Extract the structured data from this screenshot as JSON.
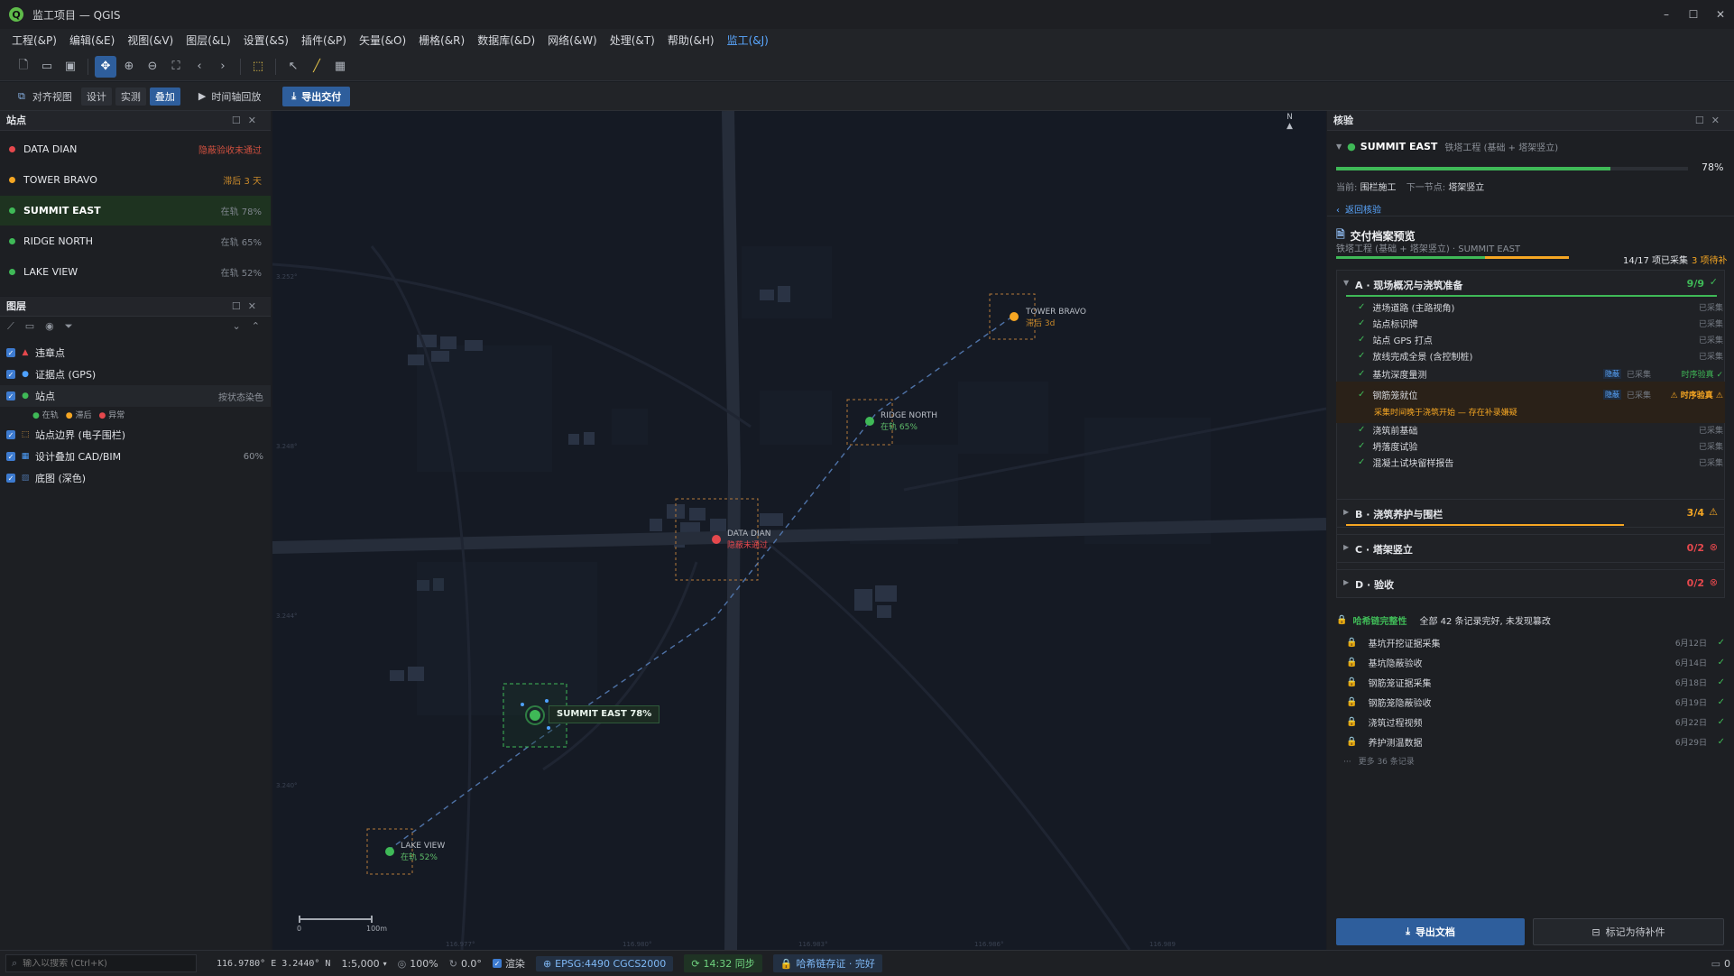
{
  "window": {
    "title": "监工项目 — QGIS",
    "controls": [
      "–",
      "☐",
      "✕"
    ]
  },
  "menu": [
    "工程(&P)",
    "编辑(&E)",
    "视图(&V)",
    "图层(&L)",
    "设置(&S)",
    "插件(&P)",
    "矢量(&O)",
    "栅格(&R)",
    "数据库(&D)",
    "网络(&W)",
    "处理(&T)",
    "帮助(&H)",
    "监工(&J)"
  ],
  "toolbar2": {
    "align_view": "对齐视图",
    "seg_design": "设计",
    "seg_survey": "实测",
    "seg_overlay": "叠加",
    "timeline": "时间轴回放",
    "export_delivery": "导出交付"
  },
  "sites_panel": {
    "title": "站点",
    "items": [
      {
        "name": "DATA DIAN",
        "status": "隐蔽验收未通过",
        "color": "#e5484d"
      },
      {
        "name": "TOWER BRAVO",
        "status": "滞后 3 天",
        "color": "#f5a623"
      },
      {
        "name": "SUMMIT EAST",
        "status": "在轨 78%",
        "color": "#3fb957"
      },
      {
        "name": "RIDGE NORTH",
        "status": "在轨 65%",
        "color": "#3fb957"
      },
      {
        "name": "LAKE VIEW",
        "status": "在轨 52%",
        "color": "#3fb957"
      }
    ]
  },
  "layers_panel": {
    "title": "图层",
    "layers": [
      {
        "name": "违章点",
        "right": ""
      },
      {
        "name": "证据点 (GPS)",
        "right": ""
      },
      {
        "name": "站点",
        "right": "按状态染色"
      },
      {
        "name": "站点边界 (电子围栏)",
        "right": ""
      },
      {
        "name": "设计叠加 CAD/BIM",
        "right": "60%"
      },
      {
        "name": "底图 (深色)",
        "right": ""
      }
    ],
    "legend": [
      "在轨",
      "滞后",
      "异常"
    ]
  },
  "map": {
    "north": "N",
    "labels": {
      "tower_bravo": "TOWER BRAVO",
      "tower_bravo_sub": "滞后 3d",
      "ridge_north": "RIDGE NORTH",
      "ridge_north_sub": "在轨 65%",
      "data_dian": "DATA DIAN",
      "data_dian_sub": "隐蔽未通过",
      "summit_east": "SUMMIT EAST 78%",
      "lake_view": "LAKE VIEW",
      "lake_view_sub": "在轨 52%"
    },
    "scale": {
      "zero": "0",
      "end": "100m"
    },
    "lat_ticks": [
      "3.252°",
      "3.248°",
      "3.244°",
      "3.240°"
    ],
    "lon_ticks": [
      "116.977°",
      "116.980°",
      "116.983°",
      "116.986°",
      "116.989"
    ]
  },
  "inspect": {
    "panel_title": "核验",
    "site_name": "SUMMIT EAST",
    "site_type": "铁塔工程 (基础 + 塔架竖立)",
    "progress_value": 78,
    "progress_pct": "78%",
    "current_label": "当前:",
    "current_value": "围栏施工",
    "next_label": "下一节点:",
    "next_value": "塔架竖立",
    "back_link": "返回核验",
    "archive_title": "交付档案预览",
    "archive_sub": "铁塔工程 (基础 + 塔架竖立) · SUMMIT EAST",
    "archive_count": "14/17 项已采集",
    "archive_pending": "3 项待补",
    "sectionA": {
      "title": "A · 现场概况与浇筑准备",
      "count": "9/9",
      "items": [
        {
          "name": "进场道路 (主路视角)",
          "tag": "",
          "status": "已采集"
        },
        {
          "name": "站点标识牌",
          "tag": "",
          "status": "已采集"
        },
        {
          "name": "站点 GPS 打点",
          "tag": "",
          "status": "已采集"
        },
        {
          "name": "放线完成全景 (含控制桩)",
          "tag": "",
          "status": "已采集"
        },
        {
          "name": "基坑深度量测",
          "tag": "隐蔽",
          "status": "已采集",
          "extra": "时序验真 ✓"
        },
        {
          "name": "钢筋笼就位",
          "tag": "隐蔽",
          "status": "已采集",
          "extra": "⚠ 时序验真 ⚠"
        },
        {
          "name": "浇筑前基础",
          "tag": "",
          "status": "已采集"
        },
        {
          "name": "坍落度试验",
          "tag": "",
          "status": "已采集"
        },
        {
          "name": "混凝土试块留样报告",
          "tag": "",
          "status": "已采集"
        }
      ],
      "warning": "采集时间晚于浇筑开始 — 存在补录嫌疑"
    },
    "sectionB": {
      "title": "B · 浇筑养护与围栏",
      "count": "3/4"
    },
    "sectionC": {
      "title": "C · 塔架竖立",
      "count": "0/2"
    },
    "sectionD": {
      "title": "D · 验收",
      "count": "0/2"
    },
    "chain_title": "哈希链完整性",
    "chain_desc": "全部 42 条记录完好, 未发现篡改",
    "chain_items": [
      {
        "name": "基坑开挖证据采集",
        "date": "6月12日"
      },
      {
        "name": "基坑隐蔽验收",
        "date": "6月14日"
      },
      {
        "name": "钢筋笼证据采集",
        "date": "6月18日"
      },
      {
        "name": "钢筋笼隐蔽验收",
        "date": "6月19日"
      },
      {
        "name": "浇筑过程视频",
        "date": "6月22日"
      },
      {
        "name": "养护测温数据",
        "date": "6月29日"
      }
    ],
    "chain_more": "更多 36 条记录",
    "export_doc": "导出文档",
    "mark_pending": "标记为待补件"
  },
  "statusbar": {
    "search_placeholder": "输入以搜索 (Ctrl+K)",
    "coords": "116.9780° E  3.2440° N",
    "scale": "1:5,000",
    "zoom": "100%",
    "rotation": "0.0°",
    "render": "渲染",
    "crs": "EPSG:4490 CGCS2000",
    "sync": "14:32 同步",
    "hash": "哈希链存证 · 完好",
    "msgs": "0"
  }
}
